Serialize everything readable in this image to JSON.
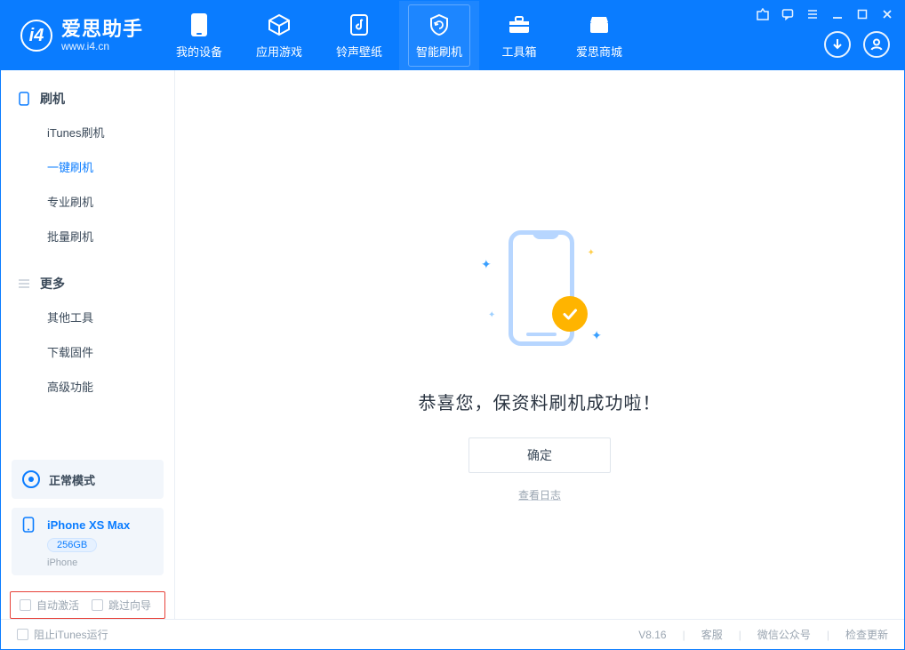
{
  "app": {
    "title": "爱思助手",
    "subtitle": "www.i4.cn"
  },
  "nav": {
    "items": [
      {
        "label": "我的设备"
      },
      {
        "label": "应用游戏"
      },
      {
        "label": "铃声壁纸"
      },
      {
        "label": "智能刷机"
      },
      {
        "label": "工具箱"
      },
      {
        "label": "爱思商城"
      }
    ]
  },
  "sidebar": {
    "group1": {
      "title": "刷机",
      "items": [
        "iTunes刷机",
        "一键刷机",
        "专业刷机",
        "批量刷机"
      ]
    },
    "group2": {
      "title": "更多",
      "items": [
        "其他工具",
        "下载固件",
        "高级功能"
      ]
    }
  },
  "mode": {
    "label": "正常模式"
  },
  "device": {
    "name": "iPhone XS Max",
    "capacity": "256GB",
    "type": "iPhone"
  },
  "options": {
    "auto_activate": "自动激活",
    "skip_guide": "跳过向导"
  },
  "main": {
    "success_text": "恭喜您，保资料刷机成功啦！",
    "ok_button": "确定",
    "view_log": "查看日志"
  },
  "footer": {
    "block_itunes": "阻止iTunes运行",
    "version": "V8.16",
    "links": [
      "客服",
      "微信公众号",
      "检查更新"
    ]
  }
}
